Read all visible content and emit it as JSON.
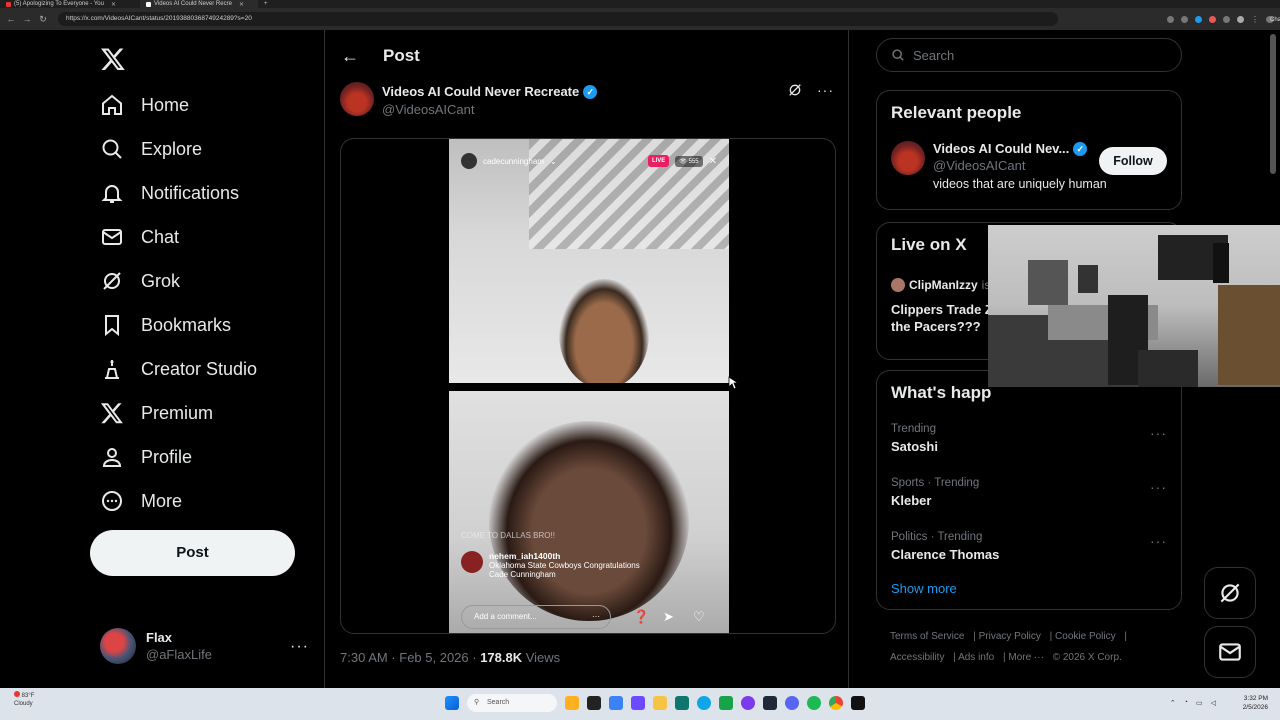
{
  "browser": {
    "tabs": [
      {
        "label": "(5) Apologizing To Everyone - You"
      },
      {
        "label": "Videos AI Could Never Recre"
      }
    ],
    "url": "https://x.com/VideosAICant/status/2019388036874924289?s=20",
    "chat_label": "Chat"
  },
  "nav": {
    "items": [
      {
        "label": "Home"
      },
      {
        "label": "Explore"
      },
      {
        "label": "Notifications"
      },
      {
        "label": "Chat"
      },
      {
        "label": "Grok"
      },
      {
        "label": "Bookmarks"
      },
      {
        "label": "Creator Studio"
      },
      {
        "label": "Premium"
      },
      {
        "label": "Profile"
      },
      {
        "label": "More"
      }
    ],
    "post_label": "Post",
    "user": {
      "name": "Flax",
      "handle": "@aFlaxLife"
    }
  },
  "post": {
    "header_title": "Post",
    "author_name": "Videos AI Could Never Recreate",
    "author_handle": "@VideosAICant",
    "video": {
      "streamer": "cadecunningham",
      "live_label": "LIVE",
      "viewers": "555",
      "faded_comment": "COME TO DALLAS BRO!!",
      "commenter": "nehem_iah1400th",
      "comment_line1": "Oklahoma State Cowboys Congratulations",
      "comment_line2": "Cade Cunningham",
      "add_comment": "Add a comment..."
    },
    "time": "7:30 AM · Feb 5, 2026 · ",
    "views_count": "178.8K",
    "views_label": " Views"
  },
  "sidebar": {
    "search_placeholder": "Search",
    "relevant": {
      "title": "Relevant people",
      "name": "Videos AI Could Nev...",
      "handle": "@VideosAICant",
      "bio": "videos that are uniquely human",
      "follow_label": "Follow"
    },
    "live": {
      "title": "Live on X",
      "user": "ClipManIzzy",
      "user_suffix": " is",
      "stream_title": "Clippers Trade Z the Pacers???"
    },
    "happening": {
      "title": "What's happ",
      "trends": [
        {
          "context": "Trending",
          "topic": "Satoshi"
        },
        {
          "context": "Sports · Trending",
          "topic": "Kleber"
        },
        {
          "context": "Politics · Trending",
          "topic": "Clarence Thomas"
        }
      ],
      "show_more": "Show more"
    },
    "footer": {
      "links": [
        "Terms of Service",
        "Privacy Policy",
        "Cookie Policy",
        "Accessibility",
        "Ads info",
        "More ···"
      ],
      "copyright": "© 2026 X Corp."
    }
  },
  "taskbar": {
    "weather_temp": "83°F",
    "weather_desc": "Cloudy",
    "search_label": "Search",
    "time": "3:32 PM",
    "date": "2/5/2026"
  },
  "colors": {
    "accent": "#1d9bf0",
    "background": "#000000",
    "border": "#2f3336",
    "muted": "#71767b",
    "live": "#e91e63"
  }
}
